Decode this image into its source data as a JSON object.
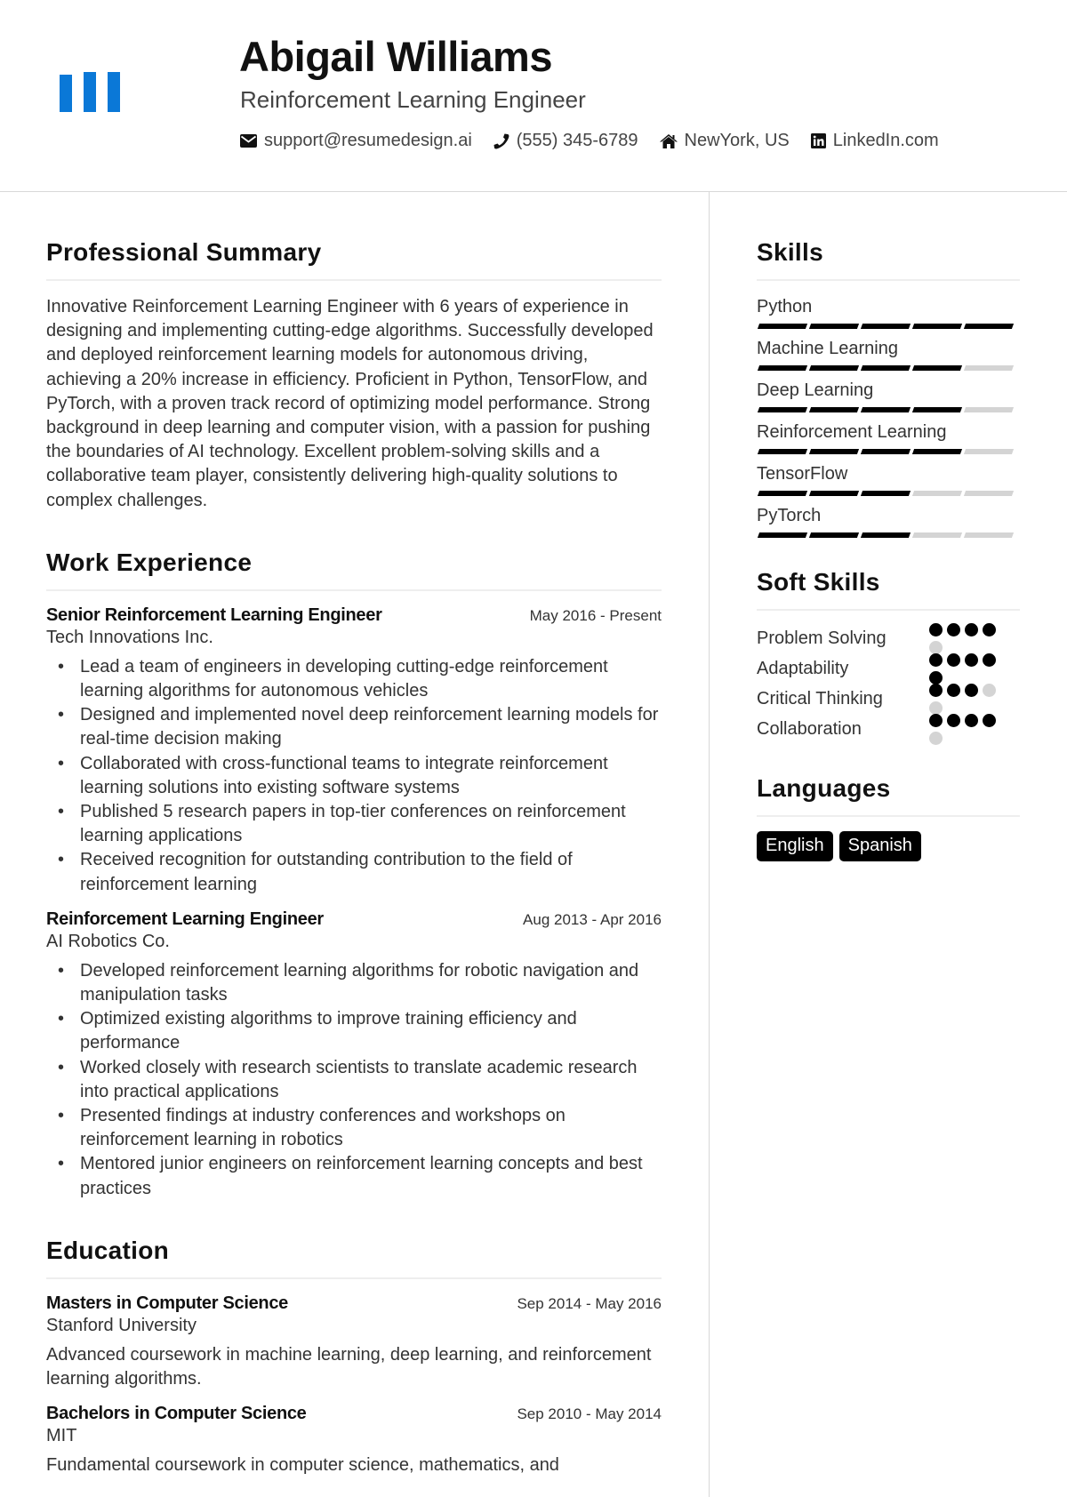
{
  "header": {
    "name": "Abigail Williams",
    "title": "Reinforcement Learning Engineer",
    "logo_color": "#0a78d7",
    "contacts": [
      {
        "icon": "envelope-icon",
        "text": "support@resumedesign.ai"
      },
      {
        "icon": "phone-icon",
        "text": "(555) 345-6789"
      },
      {
        "icon": "home-icon",
        "text": "NewYork, US"
      },
      {
        "icon": "linkedin-icon",
        "text": "LinkedIn.com"
      }
    ]
  },
  "summary": {
    "heading": "Professional Summary",
    "text": "Innovative Reinforcement Learning Engineer with 6 years of experience in designing and implementing cutting-edge algorithms. Successfully developed and deployed reinforcement learning models for autonomous driving, achieving a 20% increase in efficiency. Proficient in Python, TensorFlow, and PyTorch, with a proven track record of optimizing model performance. Strong background in deep learning and computer vision, with a passion for pushing the boundaries of AI technology. Excellent problem-solving skills and a collaborative team player, consistently delivering high-quality solutions to complex challenges."
  },
  "experience": {
    "heading": "Work Experience",
    "jobs": [
      {
        "title": "Senior Reinforcement Learning Engineer",
        "dates": "May 2016 - Present",
        "company": "Tech Innovations Inc.",
        "bullets": [
          "Lead a team of engineers in developing cutting-edge reinforcement learning algorithms for autonomous vehicles",
          "Designed and implemented novel deep reinforcement learning models for real-time decision making",
          "Collaborated with cross-functional teams to integrate reinforcement learning solutions into existing software systems",
          "Published 5 research papers in top-tier conferences on reinforcement learning applications",
          "Received recognition for outstanding contribution to the field of reinforcement learning"
        ]
      },
      {
        "title": "Reinforcement Learning Engineer",
        "dates": "Aug 2013 - Apr 2016",
        "company": "AI Robotics Co.",
        "bullets": [
          "Developed reinforcement learning algorithms for robotic navigation and manipulation tasks",
          "Optimized existing algorithms to improve training efficiency and performance",
          "Worked closely with research scientists to translate academic research into practical applications",
          "Presented findings at industry conferences and workshops on reinforcement learning in robotics",
          "Mentored junior engineers on reinforcement learning concepts and best practices"
        ]
      }
    ]
  },
  "education": {
    "heading": "Education",
    "items": [
      {
        "degree": "Masters in Computer Science",
        "dates": "Sep 2014 - May 2016",
        "school": "Stanford University",
        "description": "Advanced coursework in machine learning, deep learning, and reinforcement learning algorithms."
      },
      {
        "degree": "Bachelors in Computer Science",
        "dates": "Sep 2010 - May 2014",
        "school": "MIT",
        "description": "Fundamental coursework in computer science, mathematics, and"
      }
    ]
  },
  "skills": {
    "heading": "Skills",
    "max": 5,
    "items": [
      {
        "name": "Python",
        "level": 5
      },
      {
        "name": "Machine Learning",
        "level": 4
      },
      {
        "name": "Deep Learning",
        "level": 4
      },
      {
        "name": "Reinforcement Learning",
        "level": 4
      },
      {
        "name": "TensorFlow",
        "level": 3
      },
      {
        "name": "PyTorch",
        "level": 3
      }
    ]
  },
  "soft_skills": {
    "heading": "Soft Skills",
    "max": 5,
    "items": [
      {
        "name": "Problem Solving",
        "level": 4
      },
      {
        "name": "Adaptability",
        "level": 5
      },
      {
        "name": "Critical Thinking",
        "level": 3
      },
      {
        "name": "Collaboration",
        "level": 4
      }
    ]
  },
  "languages": {
    "heading": "Languages",
    "items": [
      "English",
      "Spanish"
    ]
  }
}
